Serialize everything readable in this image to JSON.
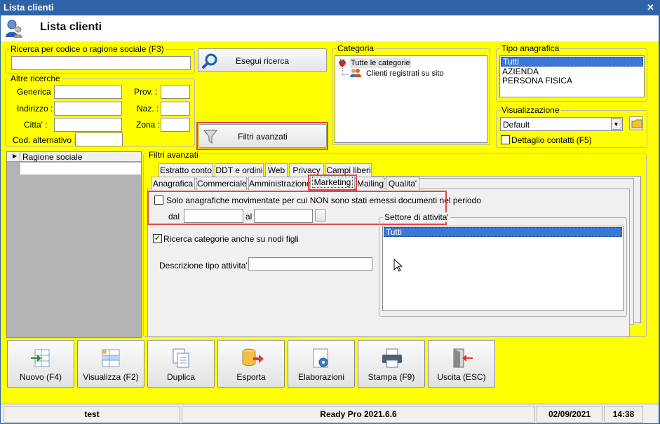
{
  "window": {
    "title": "Lista clienti",
    "header_title": "Lista clienti"
  },
  "search": {
    "code_group_label": "Ricerca per codice o ragione sociale (F3)",
    "code_value": "",
    "other_group_label": "Altre ricerche",
    "fields": {
      "generica": "Generica :",
      "indirizzo": "Indirizzo :",
      "citta": "Citta' :",
      "cod_alt": "Cod. alternativo :",
      "prov": "Prov. :",
      "naz": "Naz. :",
      "zona": "Zona :"
    },
    "search_button": "Esegui ricerca",
    "advanced_button": "Filtri avanzati"
  },
  "categoria": {
    "label": "Categoria",
    "items": [
      "Tutte le categorie",
      "Clienti registrati su sito"
    ]
  },
  "tipo_anagrafica": {
    "label": "Tipo anagrafica",
    "items": [
      "Tutti",
      "AZIENDA",
      "PERSONA FISICA"
    ]
  },
  "visualizzazione": {
    "label": "Visualizzazione",
    "selected": "Default",
    "dettaglio_label": "Dettaglio contatti (F5)"
  },
  "grid": {
    "column": "Ragione sociale"
  },
  "filtri": {
    "group_label": "Filtri avanzati",
    "tabs_row1": [
      "Estratto conto",
      "DDT e ordini",
      "Web",
      "Privacy",
      "Campi liberi"
    ],
    "tabs_row2": [
      "Anagrafica",
      "Commerciale",
      "Amministrazione",
      "Marketing",
      "Mailing",
      "Qualita'"
    ],
    "active_tab": "Marketing",
    "solo_label": "Solo anagrafiche movimentate per cui NON sono stati emessi documenti nel periodo",
    "dal": "dal",
    "al": "al",
    "ricerca_label": "Ricerca categorie anche su nodi figli",
    "descrizione_label": "Descrizione tipo attivita' :",
    "settore_label": "Settore di attivita'",
    "settore_items": [
      "Tutti"
    ]
  },
  "toolbar": {
    "nuovo": "Nuovo (F4)",
    "visualizza": "Visualizza (F2)",
    "duplica": "Duplica",
    "esporta": "Esporta",
    "elaborazioni": "Elaborazioni",
    "stampa": "Stampa (F9)",
    "uscita": "Uscita (ESC)"
  },
  "status": {
    "user": "test",
    "app": "Ready Pro 2021.6.6",
    "date": "02/09/2021",
    "time": "14:38"
  }
}
